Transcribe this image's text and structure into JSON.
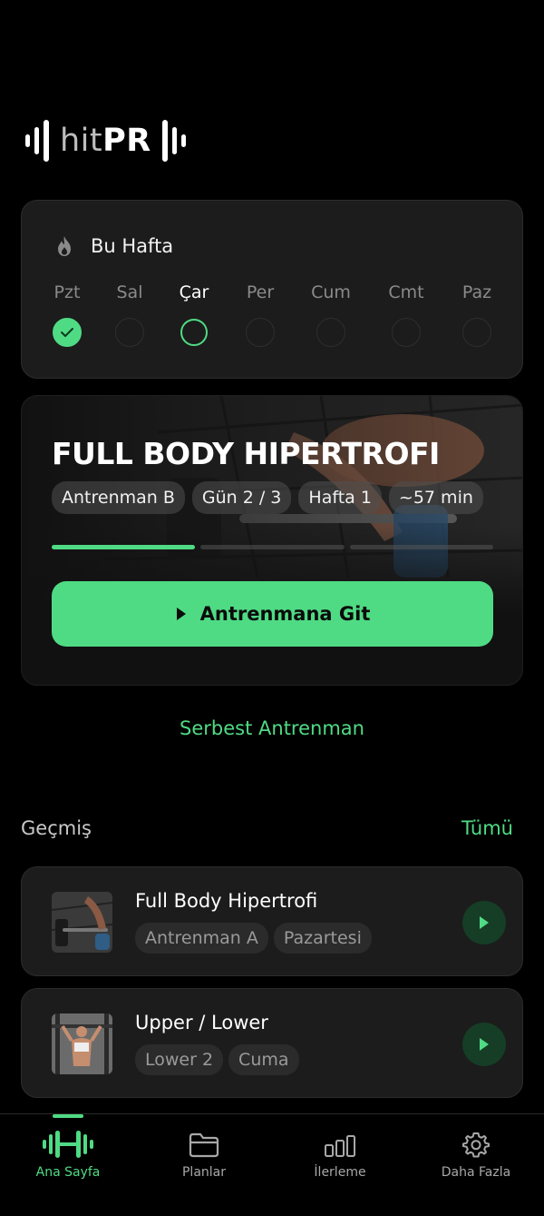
{
  "app": {
    "logo_hit": "hit",
    "logo_pr": "PR"
  },
  "colors": {
    "accent": "#4fdb84",
    "card": "#1c1c1c",
    "background": "#000000"
  },
  "week": {
    "title": "Bu Hafta",
    "icon": "flame-icon",
    "days": [
      {
        "label": "Pzt",
        "state": "done"
      },
      {
        "label": "Sal",
        "state": "empty"
      },
      {
        "label": "Çar",
        "state": "current"
      },
      {
        "label": "Per",
        "state": "empty"
      },
      {
        "label": "Cum",
        "state": "empty"
      },
      {
        "label": "Cmt",
        "state": "empty"
      },
      {
        "label": "Paz",
        "state": "empty"
      }
    ]
  },
  "current_workout": {
    "title": "FULL BODY HIPERTROFI",
    "chips": [
      "Antrenman B",
      "Gün 2 / 3",
      "Hafta 1",
      "~57 min"
    ],
    "progress_segments_done": 1,
    "progress_segments_total": 3,
    "cta_label": "Antrenmana Git"
  },
  "free_workout_label": "Serbest Antrenman",
  "history": {
    "title": "Geçmiş",
    "see_all_label": "Tümü",
    "items": [
      {
        "name": "Full Body Hipertrofi",
        "chips": [
          "Antrenman A",
          "Pazartesi"
        ]
      },
      {
        "name": "Upper / Lower",
        "chips": [
          "Lower 2",
          "Cuma"
        ]
      }
    ]
  },
  "tabs": [
    {
      "label": "Ana Sayfa",
      "icon": "dumbbell-icon",
      "active": true
    },
    {
      "label": "Planlar",
      "icon": "folder-icon",
      "active": false
    },
    {
      "label": "İlerleme",
      "icon": "bar-chart-icon",
      "active": false
    },
    {
      "label": "Daha Fazla",
      "icon": "gear-icon",
      "active": false
    }
  ]
}
